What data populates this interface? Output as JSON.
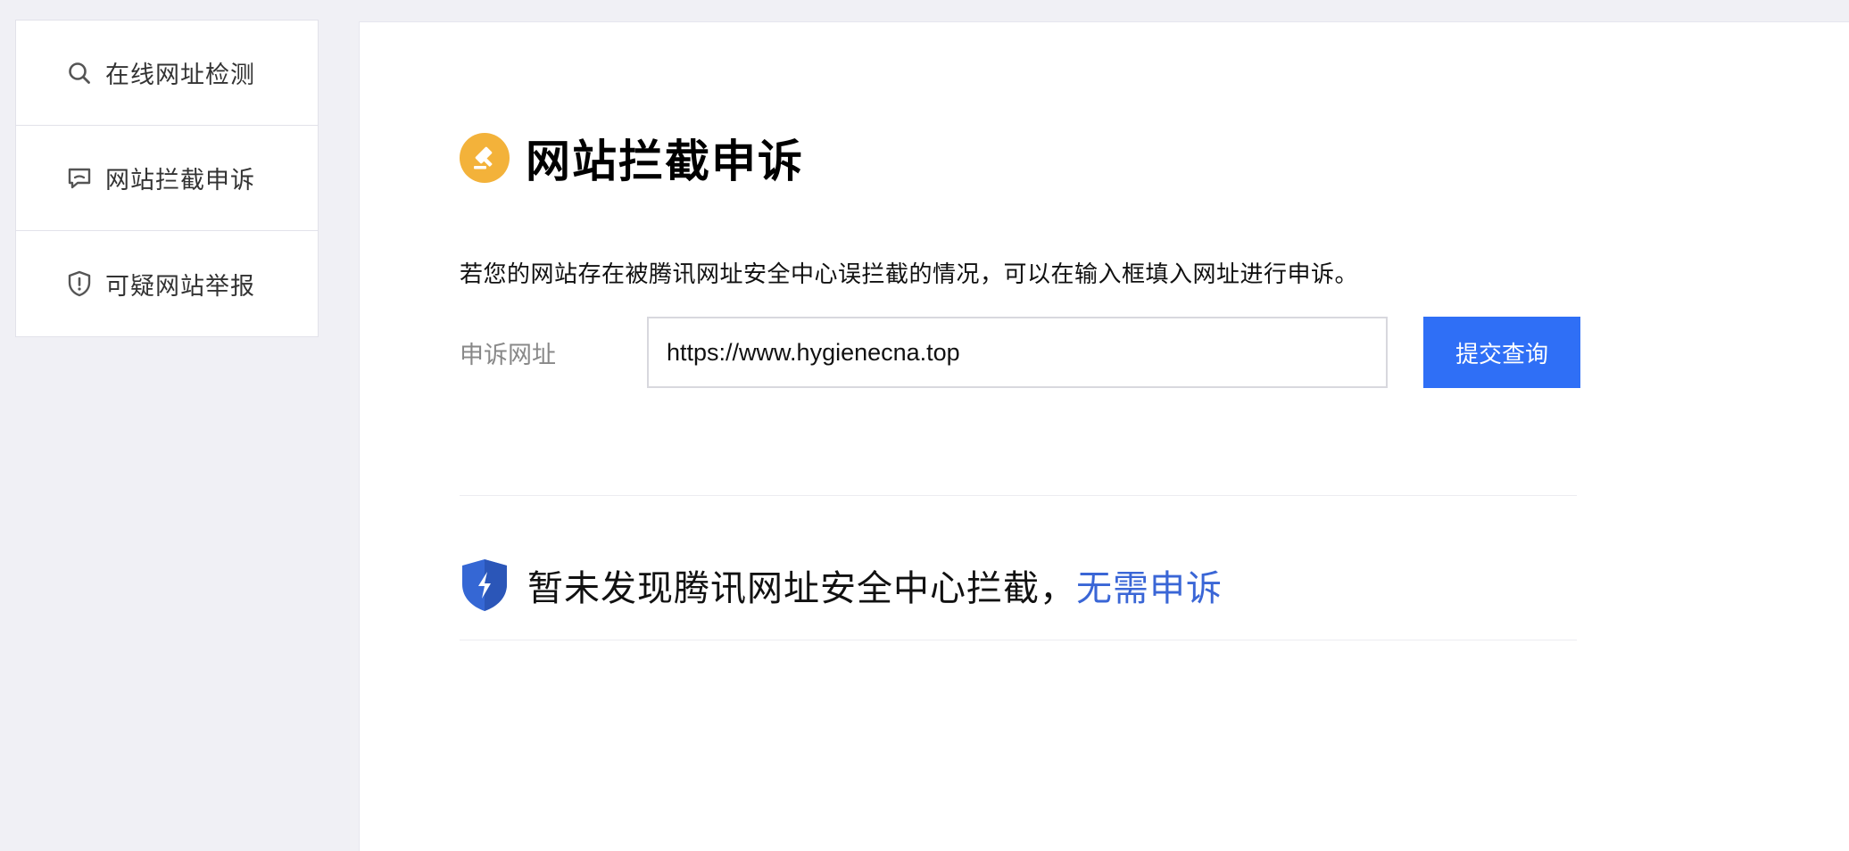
{
  "sidebar": {
    "items": [
      {
        "label": "在线网址检测",
        "icon": "search-icon"
      },
      {
        "label": "网站拦截申诉",
        "icon": "chat-bubble-icon"
      },
      {
        "label": "可疑网站举报",
        "icon": "shield-alert-icon"
      }
    ]
  },
  "main": {
    "title": "网站拦截申诉",
    "title_icon": "gavel-icon",
    "description": "若您的网站存在被腾讯网址安全中心误拦截的情况，可以在输入框填入网址进行申诉。",
    "form": {
      "label": "申诉网址",
      "url_value": "https://www.hygienecna.top",
      "submit_label": "提交查询"
    },
    "result": {
      "icon": "shield-bolt-icon",
      "message": "暂未发现腾讯网址安全中心拦截，",
      "link_text": "无需申诉"
    }
  },
  "colors": {
    "accent": "#2f6ff6",
    "link": "#3a66d6",
    "title_icon_bg": "#f3b23a",
    "shield": "#3567d4"
  }
}
